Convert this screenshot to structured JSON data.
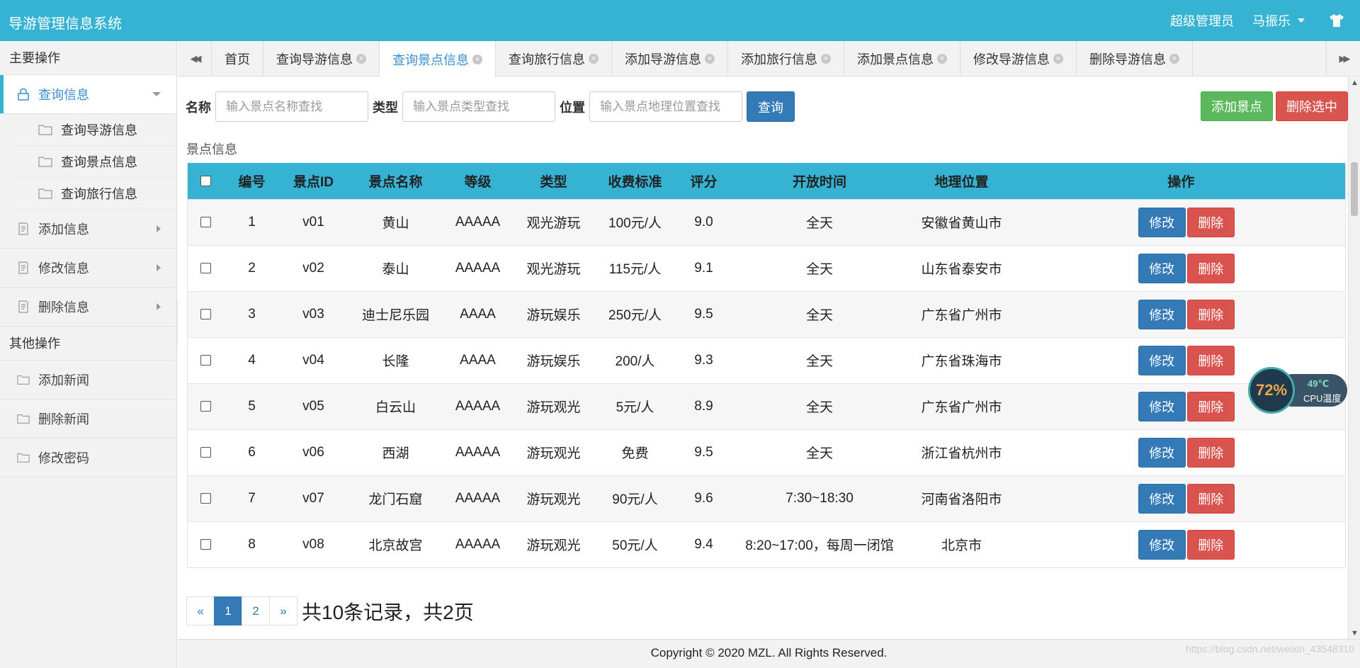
{
  "header": {
    "title": "导游管理信息系统",
    "role": "超级管理员",
    "username": "马振乐"
  },
  "sidebar": {
    "section_main": "主要操作",
    "query_group": "查询信息",
    "query_items": [
      "查询导游信息",
      "查询景点信息",
      "查询旅行信息"
    ],
    "add_group": "添加信息",
    "edit_group": "修改信息",
    "delete_group": "删除信息",
    "section_other": "其他操作",
    "other_items": [
      "添加新闻",
      "删除新闻",
      "修改密码"
    ]
  },
  "tabs": [
    {
      "label": "首页",
      "closable": false
    },
    {
      "label": "查询导游信息",
      "closable": true
    },
    {
      "label": "查询景点信息",
      "closable": true,
      "active": true
    },
    {
      "label": "查询旅行信息",
      "closable": true
    },
    {
      "label": "添加导游信息",
      "closable": true
    },
    {
      "label": "添加旅行信息",
      "closable": true
    },
    {
      "label": "添加景点信息",
      "closable": true
    },
    {
      "label": "修改导游信息",
      "closable": true
    },
    {
      "label": "删除导游信息",
      "closable": true
    }
  ],
  "filters": {
    "name_label": "名称",
    "name_placeholder": "输入景点名称查找",
    "type_label": "类型",
    "type_placeholder": "输入景点类型查找",
    "location_label": "位置",
    "location_placeholder": "输入景点地理位置查找",
    "query_button": "查询"
  },
  "actions": {
    "add": "添加景点",
    "delete_selected": "删除选中"
  },
  "section_title": "景点信息",
  "table": {
    "columns": [
      "编号",
      "景点ID",
      "景点名称",
      "等级",
      "类型",
      "收费标准",
      "评分",
      "开放时间",
      "地理位置",
      "操作"
    ],
    "edit_label": "修改",
    "delete_label": "删除",
    "rows": [
      [
        "1",
        "v01",
        "黄山",
        "AAAAA",
        "观光游玩",
        "100元/人",
        "9.0",
        "全天",
        "安徽省黄山市"
      ],
      [
        "2",
        "v02",
        "泰山",
        "AAAAA",
        "观光游玩",
        "115元/人",
        "9.1",
        "全天",
        "山东省泰安市"
      ],
      [
        "3",
        "v03",
        "迪士尼乐园",
        "AAAA",
        "游玩娱乐",
        "250元/人",
        "9.5",
        "全天",
        "广东省广州市"
      ],
      [
        "4",
        "v04",
        "长隆",
        "AAAA",
        "游玩娱乐",
        "200/人",
        "9.3",
        "全天",
        "广东省珠海市"
      ],
      [
        "5",
        "v05",
        "白云山",
        "AAAAA",
        "游玩观光",
        "5元/人",
        "8.9",
        "全天",
        "广东省广州市"
      ],
      [
        "6",
        "v06",
        "西湖",
        "AAAAA",
        "游玩观光",
        "免费",
        "9.5",
        "全天",
        "浙江省杭州市"
      ],
      [
        "7",
        "v07",
        "龙门石窟",
        "AAAAA",
        "游玩观光",
        "90元/人",
        "9.6",
        "7:30~18:30",
        "河南省洛阳市"
      ],
      [
        "8",
        "v08",
        "北京故宫",
        "AAAAA",
        "游玩观光",
        "50元/人",
        "9.4",
        "8:20~17:00，每周一闭馆",
        "北京市"
      ]
    ]
  },
  "pagination": {
    "prev": "«",
    "pages": [
      "1",
      "2"
    ],
    "current": "1",
    "next": "»",
    "summary": "共10条记录，共2页"
  },
  "footer": "Copyright © 2020 MZL. All Rights Reserved.",
  "watermark": "https://blog.csdn.net/weixin_43548310",
  "cpu_widget": {
    "usage": "72%",
    "temp": "49℃",
    "label": "CPU温度"
  },
  "colors": {
    "header_bg": "#36b3d2",
    "primary": "#337ab7",
    "success": "#5cb85c",
    "danger": "#d9534f"
  }
}
